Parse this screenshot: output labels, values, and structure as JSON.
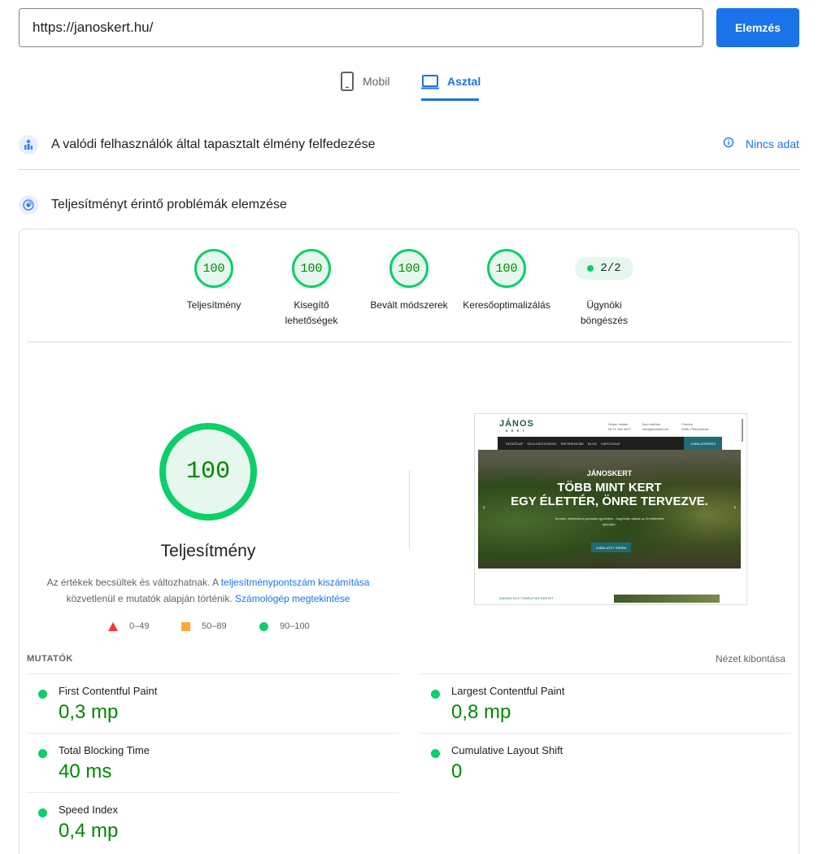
{
  "search": {
    "url": "https://janoskert.hu/",
    "button_label": "Elemzés"
  },
  "tabs": [
    {
      "label": "Mobil",
      "icon": "phone-icon",
      "active": false
    },
    {
      "label": "Asztal",
      "icon": "laptop-icon",
      "active": true
    }
  ],
  "crux": {
    "title": "A valódi felhasználók által tapasztalt élmény felfedezése",
    "status_label": "Nincs adat",
    "status_icon": "info-icon"
  },
  "diagnose": {
    "title": "Teljesítményt érintő problémák elemzése"
  },
  "categories": [
    {
      "score": "100",
      "label": "Teljesítmény"
    },
    {
      "score": "100",
      "label": "Kisegítő lehetőségek"
    },
    {
      "score": "100",
      "label": "Bevált módszerek"
    },
    {
      "score": "100",
      "label": "Keresőoptimalizálás"
    },
    {
      "score": "2/2",
      "label": "Ügynöki böngészés"
    }
  ],
  "main_gauge": {
    "score": "100",
    "label": "Teljesítmény"
  },
  "description": {
    "text1": "Az értékek becsültek és változhatnak. A ",
    "link1": "teljesítménypontszám kiszámítása",
    "text2": " közvetlenül e mutatók alapján történik. ",
    "link2": "Számológép megtekintése"
  },
  "legend": [
    {
      "range": "0–49",
      "shape": "triangle",
      "color": "#ff3333"
    },
    {
      "range": "50–89",
      "shape": "square",
      "color": "#ffaa33"
    },
    {
      "range": "90–100",
      "shape": "circle",
      "color": "#0cce6b"
    }
  ],
  "thumbnail": {
    "logo": "JÁNOS",
    "logo_sub": "KERT",
    "contact_1": "Hívjon minket\n06 20 390 4007",
    "contact_2": "Írjon nekünk\ninfo@janoskert.hu",
    "contact_3": "Címünk\n2085, Pilisvörösvár",
    "nav_items": [
      "KEZDŐLAP",
      "SZOLGÁLTATÁSOK",
      "REFERENCIÁK",
      "BLOG",
      "KAPCSOLAT"
    ],
    "nav_cta": "AJÁNLATKÉRÉS",
    "hero_sub": "JÁNOSKERT",
    "hero_line1": "TÖBB MINT KERT",
    "hero_line2": "EGY ÉLETTÉR, ÖNRE TERVEZVE.",
    "hero_text": "Tervezés, kivitelezés és gondozás egy kézben – hogy kertje valóban az Ön életteréhez igazodjon.",
    "hero_button": "AJÁNLATOT KÉREK",
    "footer_text": "SZEREZ EGY TÖKÉLETES KERTET"
  },
  "metrics": {
    "heading": "MUTATÓK",
    "expand_label": "Nézet kibontása",
    "items": [
      {
        "name": "First Contentful Paint",
        "value": "0,3 mp"
      },
      {
        "name": "Largest Contentful Paint",
        "value": "0,8 mp"
      },
      {
        "name": "Total Blocking Time",
        "value": "40 ms"
      },
      {
        "name": "Cumulative Layout Shift",
        "value": "0"
      },
      {
        "name": "Speed Index",
        "value": "0,4 mp"
      }
    ]
  },
  "colors": {
    "accent": "#1a73e8",
    "pass": "#0cce6b",
    "pass_text": "#008800",
    "pass_bg": "#e6f7ed"
  }
}
